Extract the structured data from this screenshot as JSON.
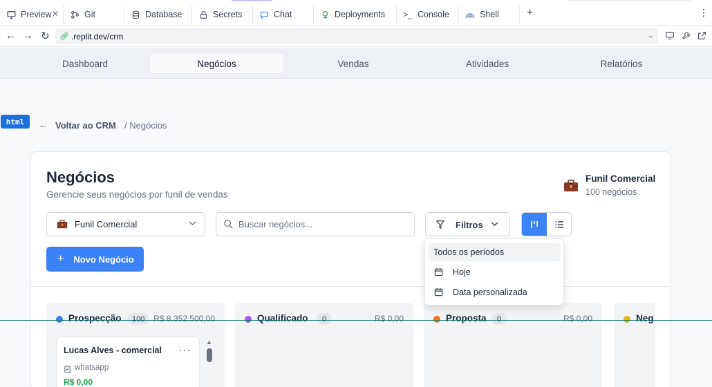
{
  "browser": {
    "tabs": [
      {
        "label": "Preview",
        "icon": "monitor-icon",
        "active": true
      },
      {
        "label": "Git",
        "icon": "git-icon"
      },
      {
        "label": "Database",
        "icon": "database-icon"
      },
      {
        "label": "Secrets",
        "icon": "lock-icon"
      },
      {
        "label": "Chat",
        "icon": "chat-icon"
      },
      {
        "label": "Deployments",
        "icon": "deploy-icon"
      },
      {
        "label": "Console",
        "icon": "terminal-icon"
      },
      {
        "label": "Shell",
        "icon": "shell-icon"
      }
    ],
    "new_tab": "+",
    "url": ".replit.dev/crm"
  },
  "appnav": {
    "items": [
      "Dashboard",
      "Negócios",
      "Vendas",
      "Atividades",
      "Relatórios"
    ],
    "active": "Negócios"
  },
  "badge": "html",
  "breadcrumb": {
    "back_label": "Voltar ao CRM",
    "current": "/ Negócios"
  },
  "page": {
    "title": "Negócios",
    "subtitle": "Gerencie seus negócios por funil de vendas",
    "funnel_title": "Funil Comercial",
    "funnel_count": "100 negócios"
  },
  "toolbar": {
    "funnel_select": "Funil Comercial",
    "search_placeholder": "Buscar negócios...",
    "filters_label": "Filtros",
    "new_button": "Novo Negócio"
  },
  "filter_menu": {
    "items": [
      "Todos os períodos",
      "Hoje",
      "Data personalizada"
    ]
  },
  "columns": [
    {
      "name": "Prospecção",
      "count": "100",
      "amount": "R$ 8.352.500,00",
      "color": "#3b82f6"
    },
    {
      "name": "Qualificado",
      "count": "0",
      "amount": "R$ 0,00",
      "color": "#a855f7"
    },
    {
      "name": "Proposta",
      "count": "0",
      "amount": "R$ 0,00",
      "color": "#f97316"
    },
    {
      "name": "Neg",
      "count": "",
      "amount": "",
      "color": "#eab308"
    }
  ],
  "deal_card": {
    "name": "Lucas Alves - comercial",
    "source": "whatsapp",
    "value": "R$ 0,00"
  },
  "colors": {
    "primary": "#3b82f6",
    "money": "#16a34a"
  }
}
